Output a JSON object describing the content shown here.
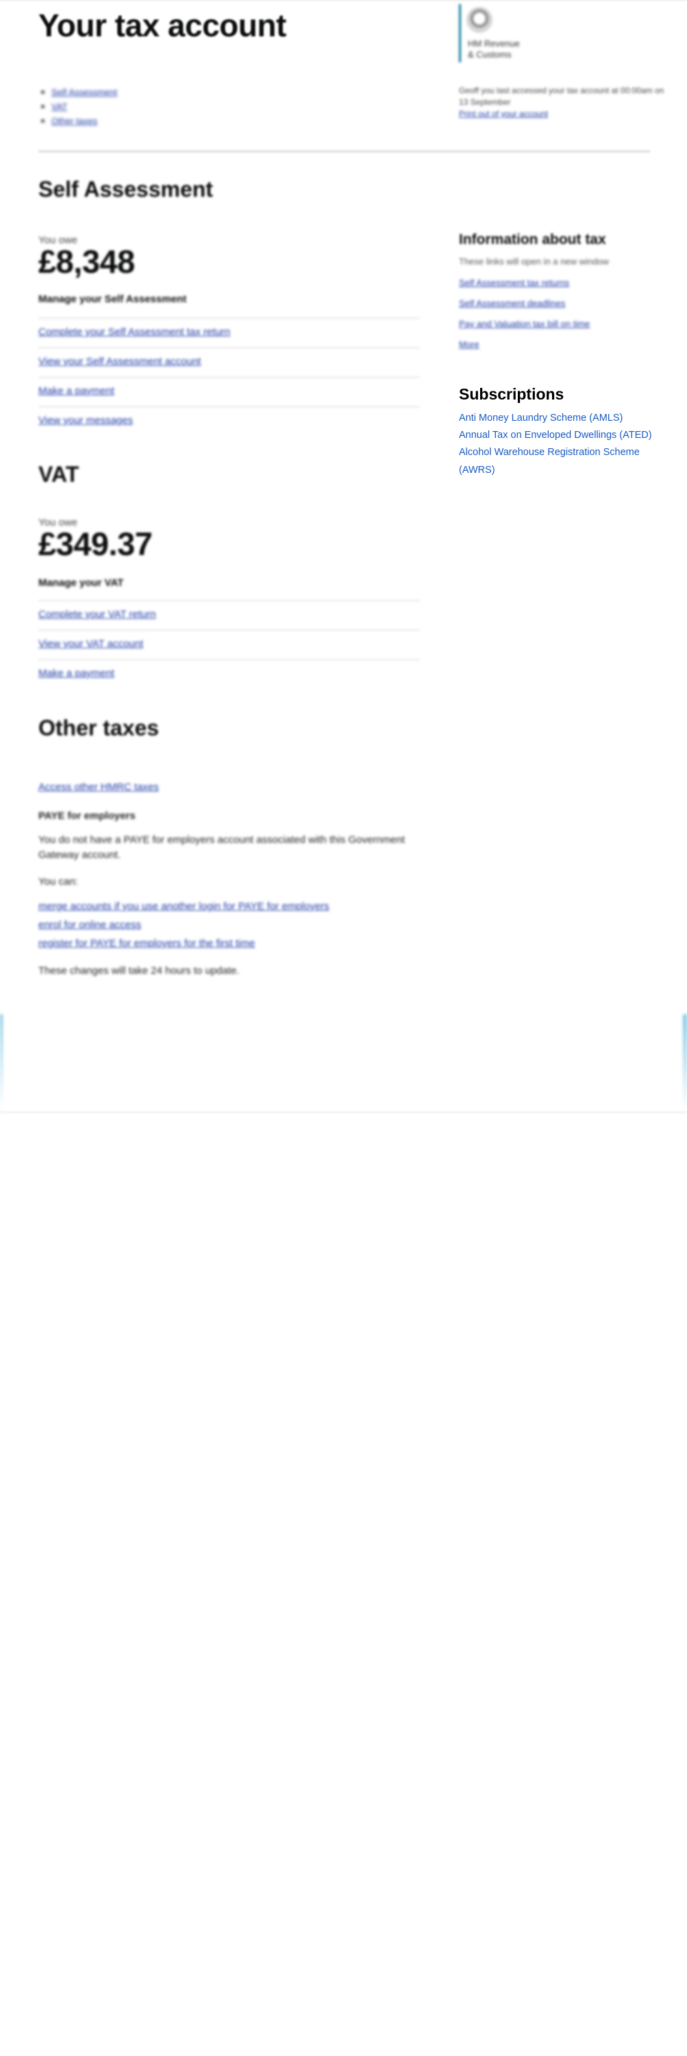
{
  "header": {
    "title": "Your tax account",
    "toc": [
      "Self Assessment",
      "VAT",
      "Other taxes"
    ],
    "agency": [
      "HM Revenue",
      "& Customs"
    ],
    "signin_text": "Geoff you last accessed your tax account at 00:00am on 13 September",
    "signin_link": "Print out of your account"
  },
  "self_assessment": {
    "heading": "Self Assessment",
    "owe_label": "You owe",
    "amount": "£8,348",
    "manage_heading": "Manage your Self Assessment",
    "links": [
      "Complete your Self Assessment tax return",
      "View your Self Assessment account",
      "Make a payment",
      "View your messages"
    ]
  },
  "vat": {
    "heading": "VAT",
    "owe_label": "You owe",
    "amount": "£349.37",
    "manage_heading": "Manage your VAT",
    "links": [
      "Complete your VAT return",
      "View your VAT account",
      "Make a payment"
    ]
  },
  "other_taxes": {
    "heading": "Other taxes",
    "access_link": "Access other HMRC taxes",
    "paye_heading": "PAYE for employers",
    "paye_text": "You do not have a PAYE for employers account associated with this Government Gateway account.",
    "you_can": "You can:",
    "links": [
      "merge accounts if you use another login for PAYE for employers",
      "enrol for online access",
      "register for PAYE for employers for the first time"
    ],
    "note": "These changes will take 24 hours to update."
  },
  "sidebar": {
    "info_heading": "Information about tax",
    "info_text": "These links will open in a new window",
    "info_links": [
      "Self Assessment tax returns",
      "Self Assessment deadlines",
      "Pay and Valuation tax bill on time",
      "More"
    ],
    "subs_heading": "Subscriptions",
    "subs_links": [
      "Anti Money Laundry Scheme (AMLS)",
      "Annual Tax on Enveloped Dwellings (ATED)",
      "Alcohol Warehouse Registration Scheme (AWRS)"
    ]
  },
  "colors": {
    "link": "#1d3aa6",
    "subscription_link": "#1a5bc4",
    "brand_bar": "#0a7a98"
  }
}
